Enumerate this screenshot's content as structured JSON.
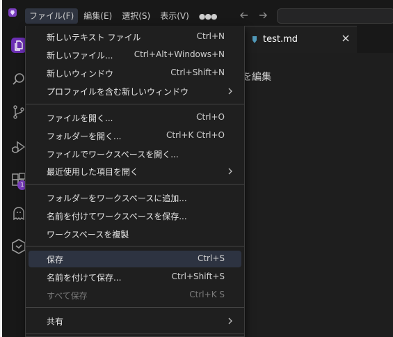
{
  "menubar": {
    "items": [
      {
        "label": "ファイル(F)",
        "active": true
      },
      {
        "label": "編集(E)"
      },
      {
        "label": "選択(S)"
      },
      {
        "label": "表示(V)"
      }
    ],
    "more_icon": "more-horizontal-icon",
    "back_icon": "arrow-left-icon",
    "forward_icon": "arrow-right-icon"
  },
  "tab": {
    "label": "test.md",
    "icon": "markdown-icon",
    "close_icon": "close-icon"
  },
  "editor": {
    "visible_text": "を編集"
  },
  "activity_bar": {
    "icons": [
      "explorer-icon",
      "search-icon",
      "source-control-icon",
      "run-debug-icon",
      "extensions-icon",
      "ghost-icon",
      "hexagon-icon"
    ],
    "extensions_badge": "1"
  },
  "file_menu": {
    "items": [
      {
        "label": "新しいテキスト ファイル",
        "shortcut": "Ctrl+N"
      },
      {
        "label": "新しいファイル...",
        "shortcut": "Ctrl+Alt+Windows+N"
      },
      {
        "label": "新しいウィンドウ",
        "shortcut": "Ctrl+Shift+N"
      },
      {
        "label": "プロファイルを含む新しいウィンドウ",
        "submenu": true
      },
      {
        "label": "ファイルを開く...",
        "shortcut": "Ctrl+O"
      },
      {
        "label": "フォルダーを開く...",
        "shortcut": "Ctrl+K Ctrl+O"
      },
      {
        "label": "ファイルでワークスペースを開く..."
      },
      {
        "label": "最近使用した項目を開く",
        "submenu": true
      },
      {
        "label": "フォルダーをワークスペースに追加..."
      },
      {
        "label": "名前を付けてワークスペースを保存..."
      },
      {
        "label": "ワークスペースを複製"
      },
      {
        "label": "保存",
        "shortcut": "Ctrl+S",
        "highlighted": true
      },
      {
        "label": "名前を付けて保存...",
        "shortcut": "Ctrl+Shift+S"
      },
      {
        "label": "すべて保存",
        "shortcut": "Ctrl+K S",
        "disabled": true
      },
      {
        "label": "共有",
        "submenu": true
      }
    ]
  },
  "colors": {
    "accent_purple": "#7b3fbf",
    "menu_background": "#1f1f1f",
    "highlight": "#2d3341"
  }
}
